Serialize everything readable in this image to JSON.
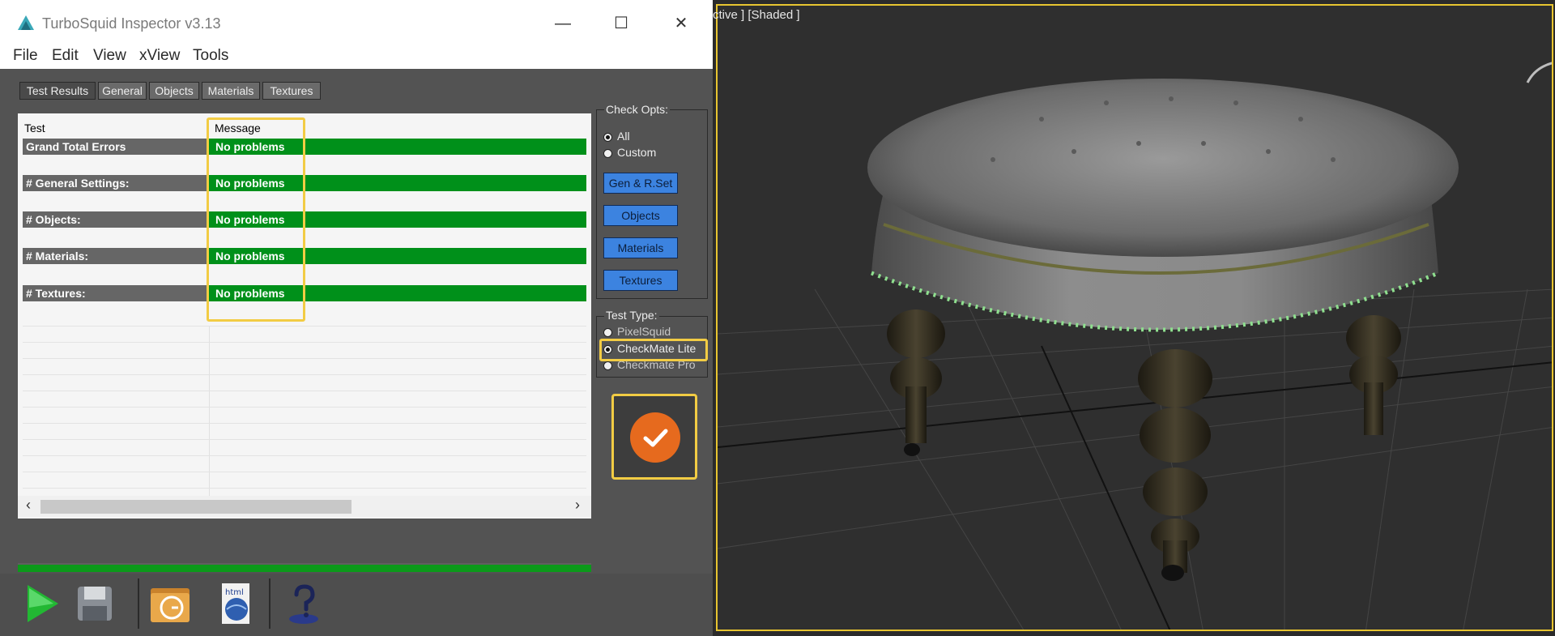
{
  "window": {
    "title": "TurboSquid Inspector v3.13",
    "controls": {
      "minimize": "—",
      "maximize": "☐",
      "close": "✕"
    }
  },
  "menu": [
    "File",
    "Edit",
    "View",
    "xView",
    "Tools"
  ],
  "tabs": [
    "Test Results",
    "General",
    "Objects",
    "Materials",
    "Textures"
  ],
  "active_tab": "Test Results",
  "table": {
    "headers": {
      "test": "Test",
      "message": "Message"
    },
    "rows": [
      {
        "test": "Grand Total Errors",
        "message": "No problems"
      },
      {
        "test": "# General Settings:",
        "message": "No problems"
      },
      {
        "test": "# Objects:",
        "message": "No problems"
      },
      {
        "test": "# Materials:",
        "message": "No problems"
      },
      {
        "test": "# Textures:",
        "message": "No problems"
      }
    ],
    "row_label_color": "#666666",
    "message_color": "#00901a"
  },
  "check_opts": {
    "legend": "Check Opts:",
    "options": [
      "All",
      "Custom"
    ],
    "selected": "All",
    "buttons": [
      "Gen & R.Set",
      "Objects",
      "Materials",
      "Textures"
    ]
  },
  "test_type": {
    "legend": "Test Type:",
    "options": [
      "PixelSquid",
      "CheckMate Lite",
      "Checkmate Pro"
    ],
    "selected": "CheckMate Lite"
  },
  "run_button": {
    "icon": "check-icon",
    "color": "#e66a1e"
  },
  "toolbar": {
    "icons": [
      "play-icon",
      "save-icon",
      "folder-icon",
      "html-icon",
      "help-icon"
    ]
  },
  "viewport": {
    "label": "ctive ] [Shaded ]",
    "highlight_color": "#e8c530"
  },
  "colors": {
    "highlight": "#f2cc44",
    "blue_button": "#3c83e0",
    "panel_bg": "#535353"
  }
}
